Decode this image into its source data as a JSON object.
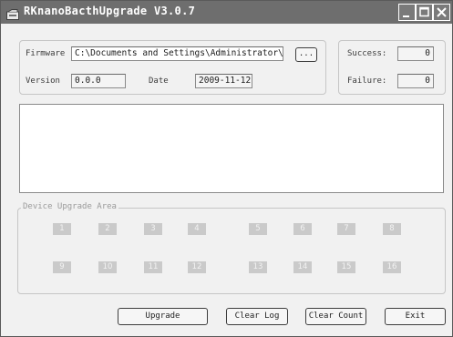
{
  "window": {
    "title": "RKnanoBacthUpgrade V3.0.7"
  },
  "firmware": {
    "label": "Firmware",
    "path": "C:\\Documents and Settings\\Administrator\\桌面",
    "browse_label": "..."
  },
  "version": {
    "label": "Version",
    "value": "0.0.0"
  },
  "date": {
    "label": "Date",
    "value": "2009-11-12"
  },
  "stats": {
    "success_label": "Success:",
    "success_value": "0",
    "failure_label": "Failure:",
    "failure_value": "0"
  },
  "log": {
    "text": ""
  },
  "devices": {
    "area_title": "Device Upgrade Area",
    "row1": [
      "1",
      "2",
      "3",
      "4",
      "5",
      "6",
      "7",
      "8"
    ],
    "row2": [
      "9",
      "10",
      "11",
      "12",
      "13",
      "14",
      "15",
      "16"
    ]
  },
  "buttons": {
    "upgrade": "Upgrade",
    "clear_log": "Clear Log",
    "clear_count": "Clear Count",
    "exit": "Exit"
  },
  "colors": {
    "titlebar": "#6e6e6e",
    "window_bg": "#f1f1f1",
    "device_slot": "#cacaca"
  },
  "icons": {
    "app": "upgrade-app-icon",
    "minimize": "minimize-icon",
    "maximize": "maximize-icon",
    "close": "close-icon"
  }
}
